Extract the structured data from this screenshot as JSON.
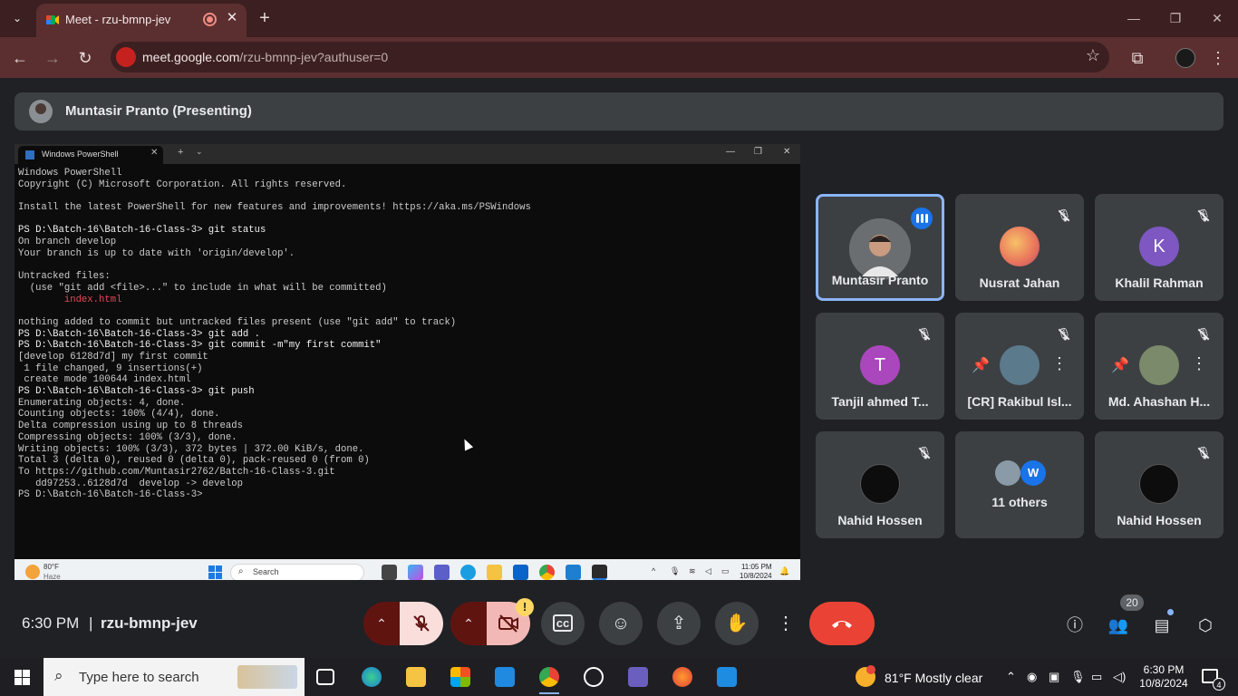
{
  "browser": {
    "tab_title": "Meet - rzu-bmnp-jev",
    "url_host": "meet.google.com",
    "url_path": "/rzu-bmnp-jev?authuser=0"
  },
  "meet": {
    "presenter_label": "Muntasir Pranto (Presenting)",
    "meeting_time": "6:30 PM",
    "separator": "|",
    "meeting_code": "rzu-bmnp-jev",
    "participant_count": "20",
    "participants": [
      {
        "name": "Muntasir Pranto",
        "initial": ""
      },
      {
        "name": "Nusrat Jahan",
        "initial": ""
      },
      {
        "name": "Khalil Rahman",
        "initial": "K"
      },
      {
        "name": "Tanjil ahmed T...",
        "initial": "T"
      },
      {
        "name": "[CR] Rakibul Isl...",
        "initial": ""
      },
      {
        "name": "Md. Ahashan H...",
        "initial": ""
      },
      {
        "name": "Nahid Hossen",
        "initial": ""
      },
      {
        "name": "11 others",
        "initial": "W"
      },
      {
        "name": "Nahid Hossen",
        "initial": ""
      }
    ],
    "camera_warning": "!"
  },
  "shared_screen": {
    "window_title": "Windows PowerShell",
    "terminal_lines": [
      {
        "t": "Windows PowerShell",
        "c": ""
      },
      {
        "t": "Copyright (C) Microsoft Corporation. All rights reserved.",
        "c": ""
      },
      {
        "t": "",
        "c": ""
      },
      {
        "t": "Install the latest PowerShell for new features and improvements! https://aka.ms/PSWindows",
        "c": ""
      },
      {
        "t": "",
        "c": ""
      },
      {
        "t": "PS D:\\Batch-16\\Batch-16-Class-3> git status",
        "c": "cmd"
      },
      {
        "t": "On branch develop",
        "c": ""
      },
      {
        "t": "Your branch is up to date with 'origin/develop'.",
        "c": ""
      },
      {
        "t": "",
        "c": ""
      },
      {
        "t": "Untracked files:",
        "c": ""
      },
      {
        "t": "  (use \"git add <file>...\" to include in what will be committed)",
        "c": ""
      },
      {
        "t": "        index.html",
        "c": "red"
      },
      {
        "t": "",
        "c": ""
      },
      {
        "t": "nothing added to commit but untracked files present (use \"git add\" to track)",
        "c": ""
      },
      {
        "t": "PS D:\\Batch-16\\Batch-16-Class-3> git add .",
        "c": "cmd"
      },
      {
        "t": "PS D:\\Batch-16\\Batch-16-Class-3> git commit -m\"my first commit\"",
        "c": "cmd"
      },
      {
        "t": "[develop 6128d7d] my first commit",
        "c": ""
      },
      {
        "t": " 1 file changed, 9 insertions(+)",
        "c": ""
      },
      {
        "t": " create mode 100644 index.html",
        "c": ""
      },
      {
        "t": "PS D:\\Batch-16\\Batch-16-Class-3> git push",
        "c": "cmd"
      },
      {
        "t": "Enumerating objects: 4, done.",
        "c": ""
      },
      {
        "t": "Counting objects: 100% (4/4), done.",
        "c": ""
      },
      {
        "t": "Delta compression using up to 8 threads",
        "c": ""
      },
      {
        "t": "Compressing objects: 100% (3/3), done.",
        "c": ""
      },
      {
        "t": "Writing objects: 100% (3/3), 372 bytes | 372.00 KiB/s, done.",
        "c": ""
      },
      {
        "t": "Total 3 (delta 0), reused 0 (delta 0), pack-reused 0 (from 0)",
        "c": ""
      },
      {
        "t": "To https://github.com/Muntasir2762/Batch-16-Class-3.git",
        "c": ""
      },
      {
        "t": "   dd97253..6128d7d  develop -> develop",
        "c": ""
      },
      {
        "t": "PS D:\\Batch-16\\Batch-16-Class-3>",
        "c": ""
      }
    ],
    "taskbar_temp": "80°F",
    "taskbar_weather": "Haze",
    "taskbar_search": "Search",
    "taskbar_time": "11:05 PM",
    "taskbar_date": "10/8/2024"
  },
  "windows_taskbar": {
    "search_placeholder": "Type here to search",
    "weather": "81°F  Mostly clear",
    "time": "6:30 PM",
    "date": "10/8/2024",
    "notification_count": "4"
  }
}
